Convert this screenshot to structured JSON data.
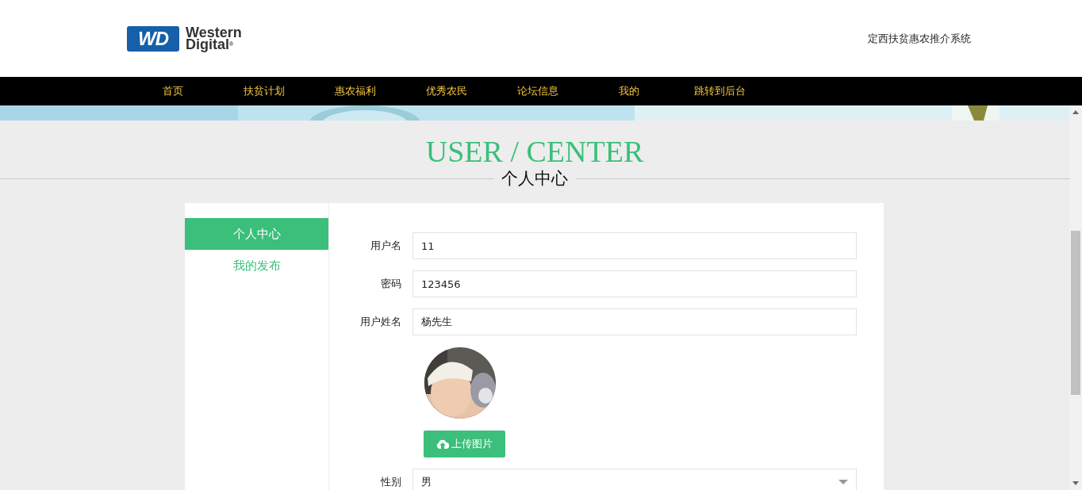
{
  "logo": {
    "mark": "WD",
    "lines": [
      "Western",
      "Digital$^{®}$"
    ]
  },
  "site_title": "定西扶贫惠农推介系统",
  "nav": [
    {
      "label": "首页"
    },
    {
      "label": "扶贫计划"
    },
    {
      "label": "惠农福利"
    },
    {
      "label": "优秀农民"
    },
    {
      "label": "论坛信息"
    },
    {
      "label": "我的"
    },
    {
      "label": "跳转到后台"
    }
  ],
  "heading": {
    "title": "USER / CENTER",
    "subtitle": "个人中心"
  },
  "sidebar": {
    "items": [
      {
        "label": "个人中心",
        "selected": true
      },
      {
        "label": "我的发布",
        "selected": false
      }
    ]
  },
  "form": {
    "fields": [
      {
        "kind": "text",
        "label": "用户名",
        "value": "11"
      },
      {
        "kind": "text",
        "label": "密码",
        "value": "123456"
      },
      {
        "kind": "text",
        "label": "用户姓名",
        "value": "杨先生"
      },
      {
        "kind": "avatar",
        "button": "上传图片"
      },
      {
        "kind": "select",
        "label": "性别",
        "value": "男"
      }
    ]
  }
}
